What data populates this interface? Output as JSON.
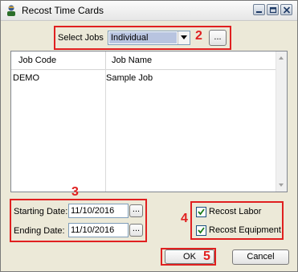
{
  "window": {
    "title": "Recost Time Cards",
    "buttons": [
      "minimize",
      "restore",
      "close"
    ]
  },
  "select_jobs": {
    "label": "Select Jobs",
    "value": "Individual",
    "browse_label": "...",
    "annotation": "2"
  },
  "job_list": {
    "columns": [
      "Job Code",
      "Job Name"
    ],
    "rows": [
      {
        "code": "DEMO",
        "name": "Sample Job"
      }
    ]
  },
  "dates": {
    "annotation": "3",
    "starting": {
      "label": "Starting Date:",
      "value": "11/10/2016",
      "browse_label": "..."
    },
    "ending": {
      "label": "Ending Date:",
      "value": "11/10/2016",
      "browse_label": "..."
    }
  },
  "options": {
    "annotation": "4",
    "recost_labor": {
      "label": "Recost Labor",
      "checked": true
    },
    "recost_equipment": {
      "label": "Recost Equipment",
      "checked": true
    }
  },
  "actions": {
    "ok_label": "OK",
    "ok_annotation": "5",
    "cancel_label": "Cancel"
  },
  "colors": {
    "annotation_red": "#e02020",
    "selection_blue": "#b8c4e0",
    "dialog_bg": "#ece9d8"
  }
}
